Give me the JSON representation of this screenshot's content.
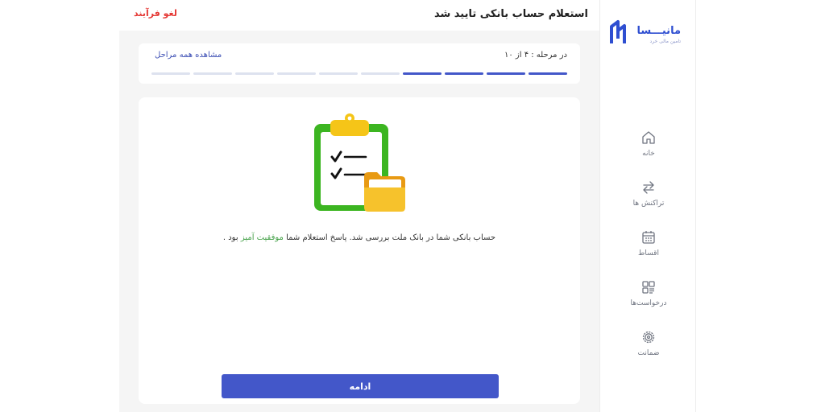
{
  "header": {
    "title": "استعلام حساب بانکی تایید شد",
    "cancel_label": "لغو فرآیند"
  },
  "brand": {
    "name": "مانیـــسا",
    "tagline": "تامین مالی خرد",
    "color": "#2f4fd1"
  },
  "sidebar": {
    "items": [
      {
        "label": "خانه",
        "icon": "home-icon"
      },
      {
        "label": "تراکنش ها",
        "icon": "transfer-icon"
      },
      {
        "label": "اقساط",
        "icon": "calendar-icon"
      },
      {
        "label": "درخواست‌ها",
        "icon": "grid-icon"
      },
      {
        "label": "ضمانت",
        "icon": "gear-icon"
      }
    ]
  },
  "progress": {
    "step_text": "در مرحله : ۴ از ۱۰",
    "current_step": 4,
    "total_steps": 10,
    "view_all_label": "مشاهده همه مراحل",
    "active_color": "#4357c9",
    "inactive_color": "#dde2ef"
  },
  "content": {
    "illustration": "clipboard-checklist-folder-icon",
    "message_prefix": "حساب بانکی شما در بانک ملت بررسی شد. پاسخ استعلام شما",
    "message_highlight": "موفقیت آمیز",
    "message_suffix": "بود .",
    "highlight_color": "#43a047"
  },
  "actions": {
    "continue_label": "ادامه"
  }
}
